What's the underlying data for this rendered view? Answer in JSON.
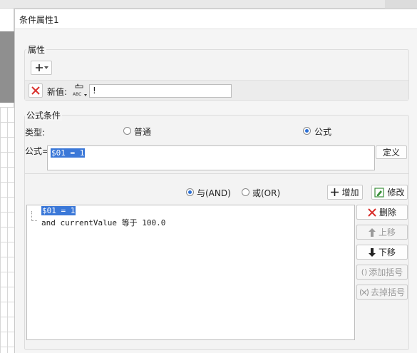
{
  "dialog": {
    "title": "条件属性1"
  },
  "attributes_group": {
    "title": "属性",
    "new_value_label": "新值:",
    "new_value_input": "!"
  },
  "formula_group": {
    "title": "公式条件",
    "type_label": "类型:",
    "type_options": [
      {
        "label": "普通",
        "selected": false
      },
      {
        "label": "公式",
        "selected": true
      }
    ],
    "formula_label": "公式=",
    "formula_value": "$01 = 1",
    "define_button": "定义"
  },
  "conditions": {
    "logic_options": [
      {
        "label": "与(AND)",
        "selected": true
      },
      {
        "label": "或(OR)",
        "selected": false
      }
    ],
    "add_button": "增加",
    "modify_button": "修改",
    "lines": [
      "$01 = 1",
      "and currentValue 等于 100.0"
    ]
  },
  "side_buttons": {
    "delete": "删除",
    "move_up": "上移",
    "move_down": "下移",
    "add_bracket": "添加括号",
    "remove_bracket": "去掉括号"
  },
  "colors": {
    "selection": "#3b78d8",
    "delete_red": "#d9302c",
    "radio_blue": "#2b6fd6"
  }
}
